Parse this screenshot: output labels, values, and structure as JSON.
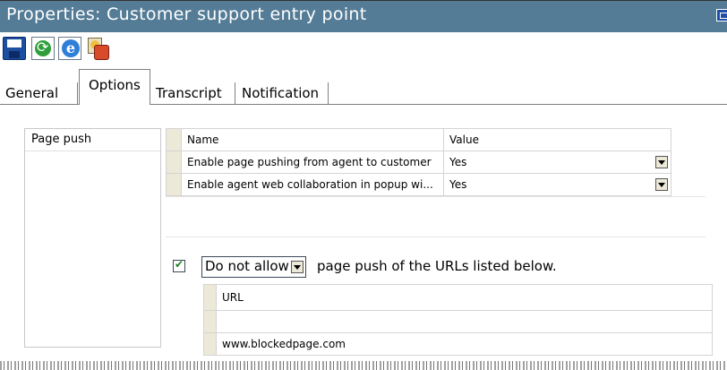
{
  "window": {
    "title": "Properties: Customer support entry point"
  },
  "toolbar": {
    "icons": [
      "save-icon",
      "refresh-icon",
      "internet-explorer-icon",
      "properties-icon"
    ]
  },
  "tabs": [
    {
      "label": "General"
    },
    {
      "label": "Options",
      "active": true
    },
    {
      "label": "Transcript"
    },
    {
      "label": "Notification"
    }
  ],
  "sidebar": {
    "items": [
      {
        "label": "Page push"
      }
    ]
  },
  "properties_table": {
    "headers": {
      "name": "Name",
      "value": "Value"
    },
    "rows": [
      {
        "name": "Enable page pushing from agent to customer",
        "value": "Yes"
      },
      {
        "name": "Enable agent web collaboration in popup wi...",
        "value": "Yes"
      }
    ]
  },
  "filter": {
    "checked": true,
    "mode": "Do not allow",
    "text": "page push of the URLs listed below."
  },
  "url_table": {
    "header": "URL",
    "rows": [
      "",
      "www.blockedpage.com"
    ]
  },
  "colors": {
    "titlebar": "#547c96",
    "rowheader": "#ece9d8"
  }
}
